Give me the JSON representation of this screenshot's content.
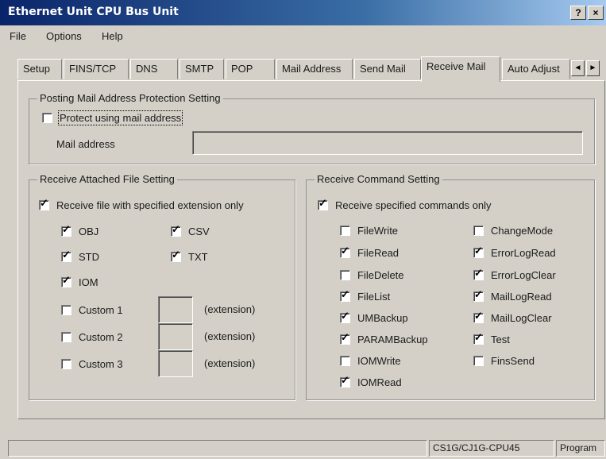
{
  "window": {
    "title": "Ethernet Unit CPU Bus Unit",
    "help_button": "?",
    "close_button": "×"
  },
  "menu": [
    "File",
    "Options",
    "Help"
  ],
  "tabs": [
    {
      "label": "Setup",
      "active": false
    },
    {
      "label": "FINS/TCP",
      "active": false
    },
    {
      "label": "DNS",
      "active": false
    },
    {
      "label": "SMTP",
      "active": false
    },
    {
      "label": "POP",
      "active": false
    },
    {
      "label": "Mail Address",
      "active": false
    },
    {
      "label": "Send Mail",
      "active": false
    },
    {
      "label": "Receive Mail",
      "active": true
    },
    {
      "label": "Auto Adjust",
      "active": false
    }
  ],
  "tab_scroll": {
    "left": "◄",
    "right": "►"
  },
  "posting_group": {
    "legend": "Posting Mail Address Protection Setting",
    "protect_checkbox": {
      "label": "Protect using mail address",
      "checked": false
    },
    "mail_address_label": "Mail address",
    "mail_address_value": ""
  },
  "attached_group": {
    "legend": "Receive Attached File Setting",
    "ext_only": {
      "label": "Receive file with specified extension only",
      "checked": true
    },
    "ext_items": [
      {
        "label": "OBJ",
        "checked": true
      },
      {
        "label": "CSV",
        "checked": true
      },
      {
        "label": "STD",
        "checked": true
      },
      {
        "label": "TXT",
        "checked": true
      },
      {
        "label": "IOM",
        "checked": true
      }
    ],
    "custom": [
      {
        "label": "Custom 1",
        "checked": false,
        "value": "",
        "suffix": "(extension)"
      },
      {
        "label": "Custom 2",
        "checked": false,
        "value": "",
        "suffix": "(extension)"
      },
      {
        "label": "Custom 3",
        "checked": false,
        "value": "",
        "suffix": "(extension)"
      }
    ]
  },
  "command_group": {
    "legend": "Receive Command Setting",
    "specified_only": {
      "label": "Receive specified commands only",
      "checked": true
    },
    "left_commands": [
      {
        "label": "FileWrite",
        "checked": false
      },
      {
        "label": "FileRead",
        "checked": true
      },
      {
        "label": "FileDelete",
        "checked": false
      },
      {
        "label": "FileList",
        "checked": true
      },
      {
        "label": "UMBackup",
        "checked": true
      },
      {
        "label": "PARAMBackup",
        "checked": true
      },
      {
        "label": "IOMWrite",
        "checked": false
      },
      {
        "label": "IOMRead",
        "checked": true
      }
    ],
    "right_commands": [
      {
        "label": "ChangeMode",
        "checked": false
      },
      {
        "label": "ErrorLogRead",
        "checked": true
      },
      {
        "label": "ErrorLogClear",
        "checked": true
      },
      {
        "label": "MailLogRead",
        "checked": true
      },
      {
        "label": "MailLogClear",
        "checked": true
      },
      {
        "label": "Test",
        "checked": true
      },
      {
        "label": "FinsSend",
        "checked": false
      }
    ]
  },
  "status": {
    "device": "CS1G/CJ1G-CPU45",
    "mode": "Program"
  },
  "check_glyph": "✓"
}
